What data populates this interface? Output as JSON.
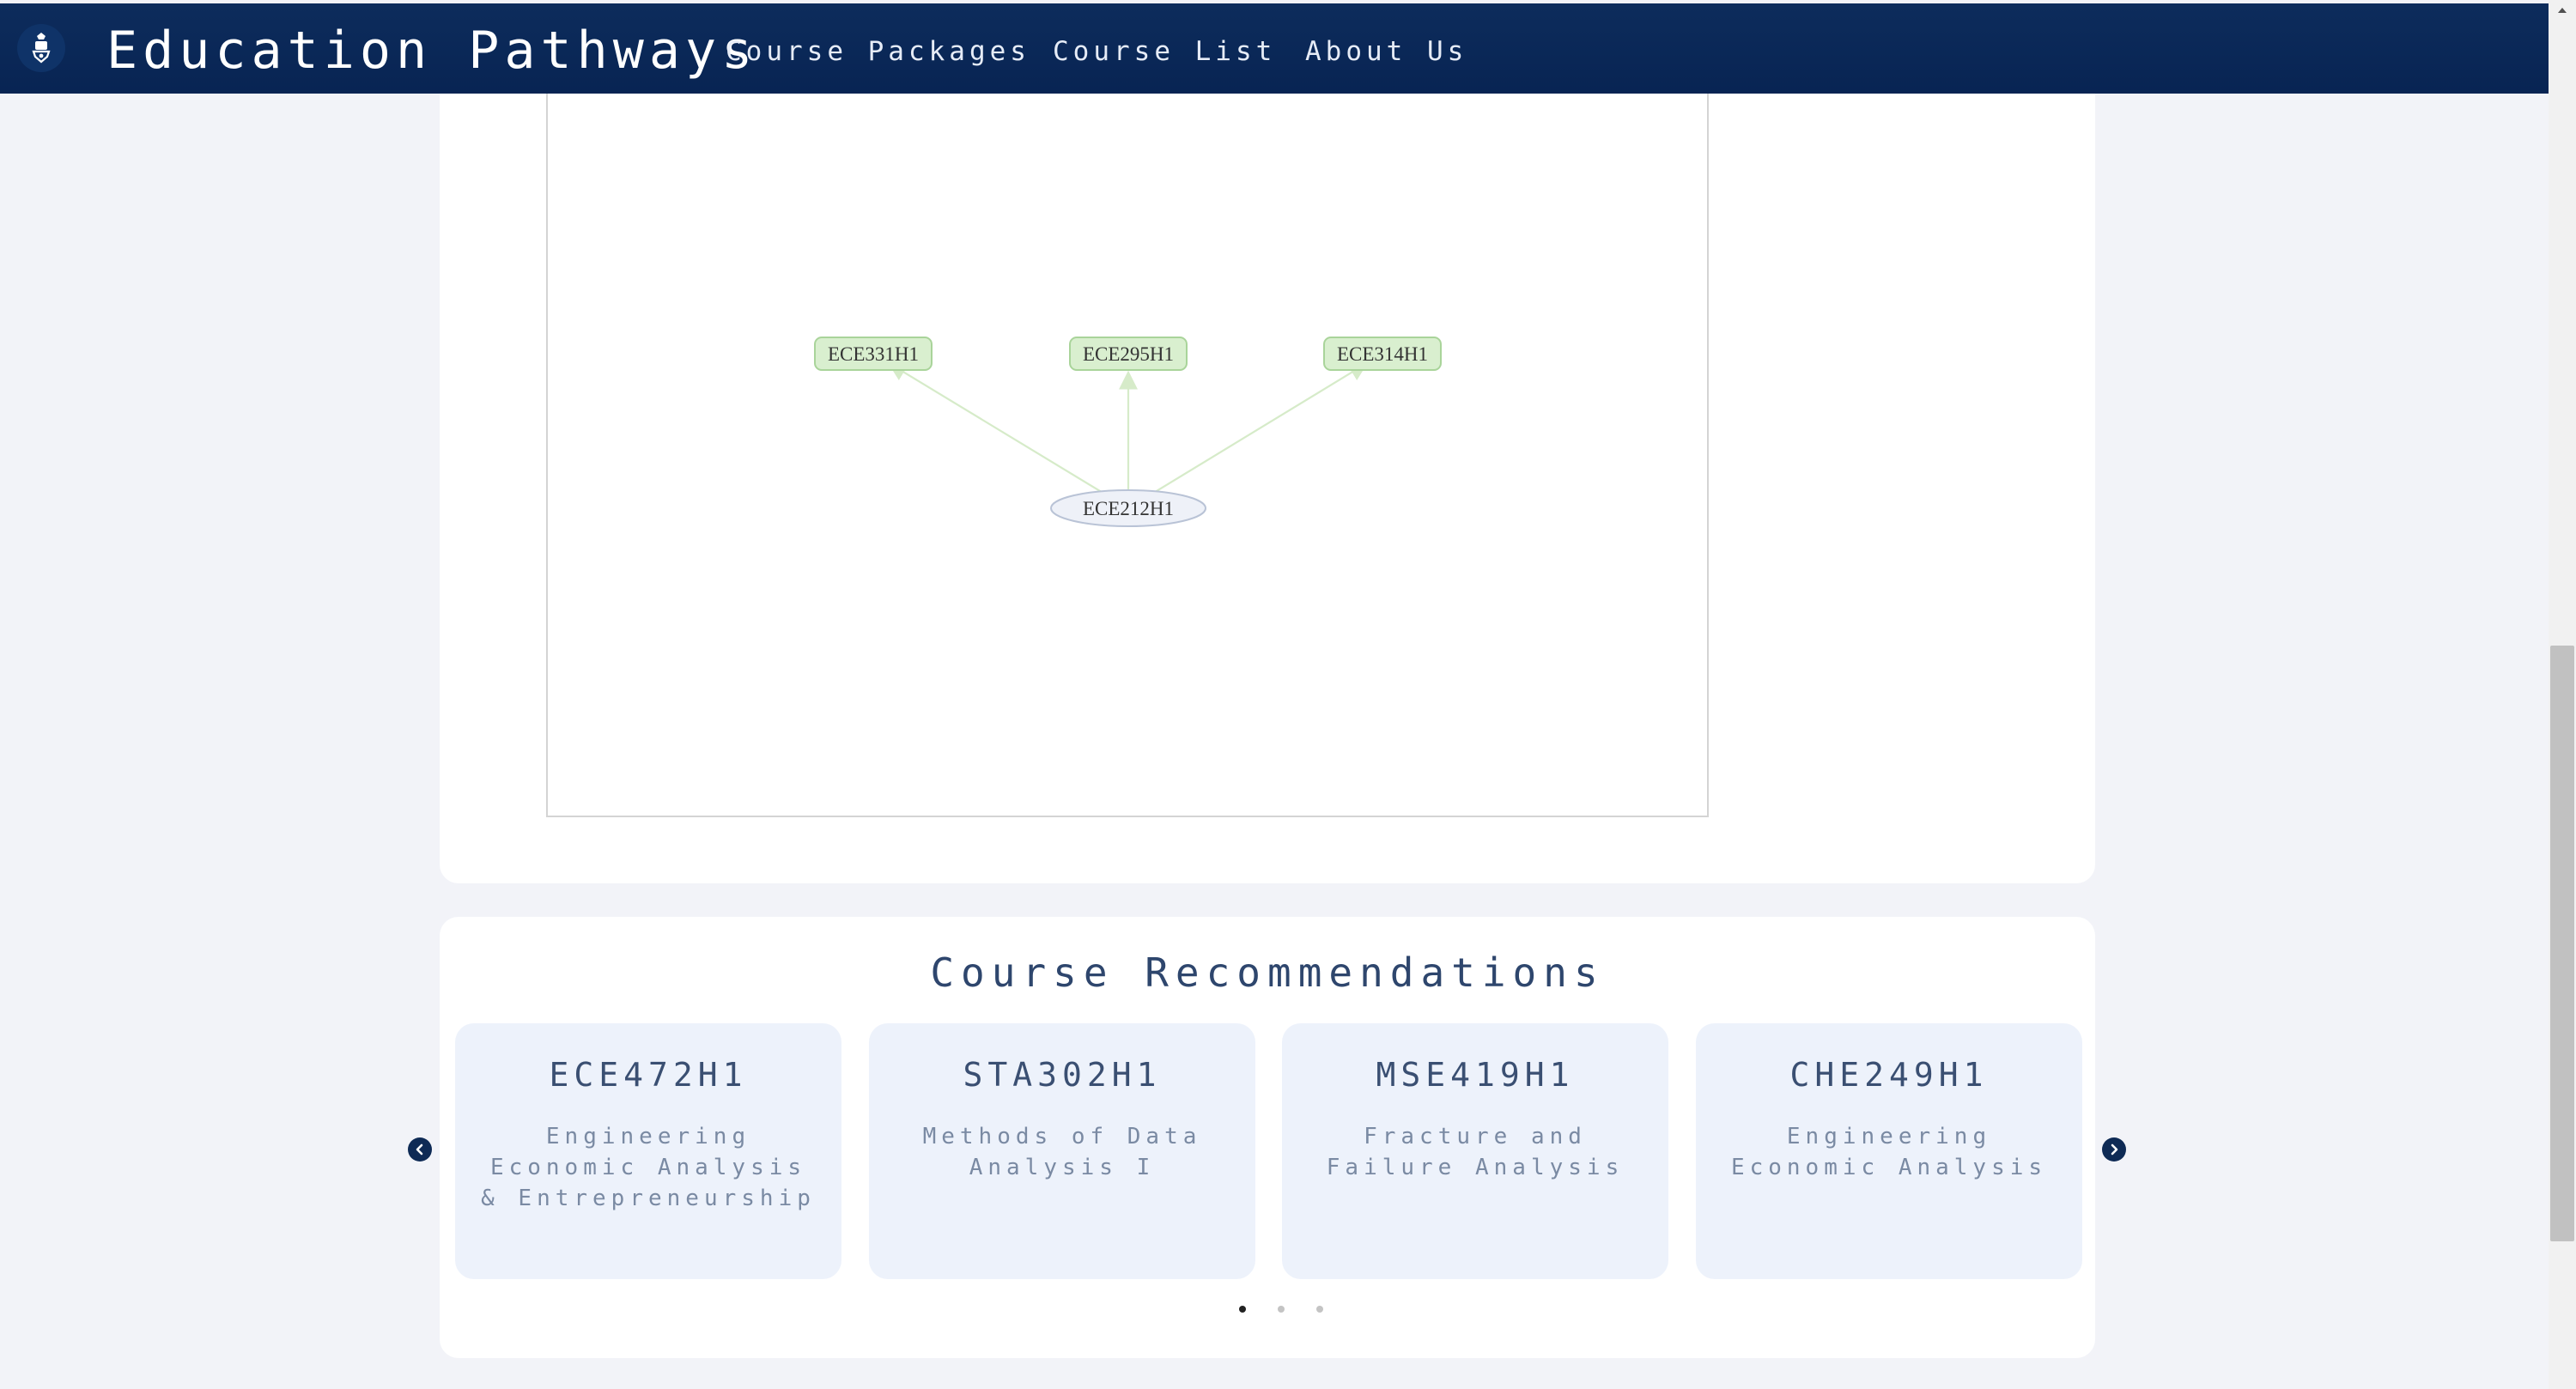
{
  "header": {
    "brand": "Education Pathways",
    "nav": [
      "Course Packages",
      "Course List",
      "About Us"
    ]
  },
  "graph": {
    "nodes": [
      {
        "id": "ECE331H1",
        "kind": "postreq"
      },
      {
        "id": "ECE295H1",
        "kind": "postreq"
      },
      {
        "id": "ECE314H1",
        "kind": "postreq"
      },
      {
        "id": "ECE212H1",
        "kind": "current"
      }
    ],
    "edges": [
      {
        "from": "ECE212H1",
        "to": "ECE331H1"
      },
      {
        "from": "ECE212H1",
        "to": "ECE295H1"
      },
      {
        "from": "ECE212H1",
        "to": "ECE314H1"
      }
    ],
    "colors": {
      "postreq_fill": "#d9efcf",
      "postreq_stroke": "#a9d49a",
      "current_fill": "#eef1f8",
      "current_stroke": "#b9c3d6",
      "edge": "#d6ebc9"
    }
  },
  "recommendations": {
    "title": "Course Recommendations",
    "cards": [
      {
        "code": "ECE472H1",
        "name": "Engineering Economic Analysis & Entrepreneurship"
      },
      {
        "code": "STA302H1",
        "name": "Methods of Data Analysis I"
      },
      {
        "code": "MSE419H1",
        "name": "Fracture and Failure Analysis"
      },
      {
        "code": "CHE249H1",
        "name": "Engineering Economic Analysis"
      }
    ],
    "pages": 3,
    "active_page": 1
  },
  "colors": {
    "navbar": "#0a2857",
    "page_bg": "#f2f3f8",
    "card_bg": "#edf2fb"
  }
}
